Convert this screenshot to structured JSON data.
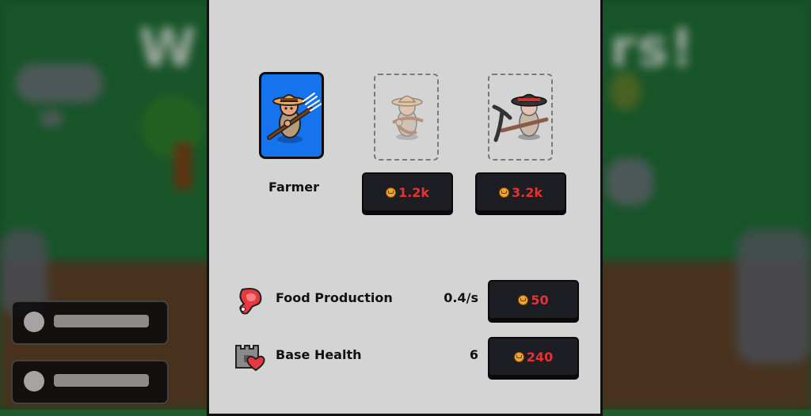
{
  "background": {
    "title_left": "W",
    "title_right": "rs!"
  },
  "units": [
    {
      "name": "Farmer",
      "state": "unlocked",
      "icon": "farmer-icon"
    },
    {
      "name": "",
      "state": "locked",
      "icon": "fisherman-icon",
      "price": "1.2k"
    },
    {
      "name": "",
      "state": "locked",
      "icon": "miner-icon",
      "price": "3.2k"
    }
  ],
  "upgrades": [
    {
      "label": "Food Production",
      "value": "0.4/s",
      "price": "50",
      "icon": "meat-icon"
    },
    {
      "label": "Base Health",
      "value": "6",
      "price": "240",
      "icon": "castle-heart-icon"
    }
  ],
  "colors": {
    "panel": "#d4d4d4",
    "active_card": "#1573ee",
    "price_text": "#e83232",
    "button_bg": "#1d1d24"
  }
}
